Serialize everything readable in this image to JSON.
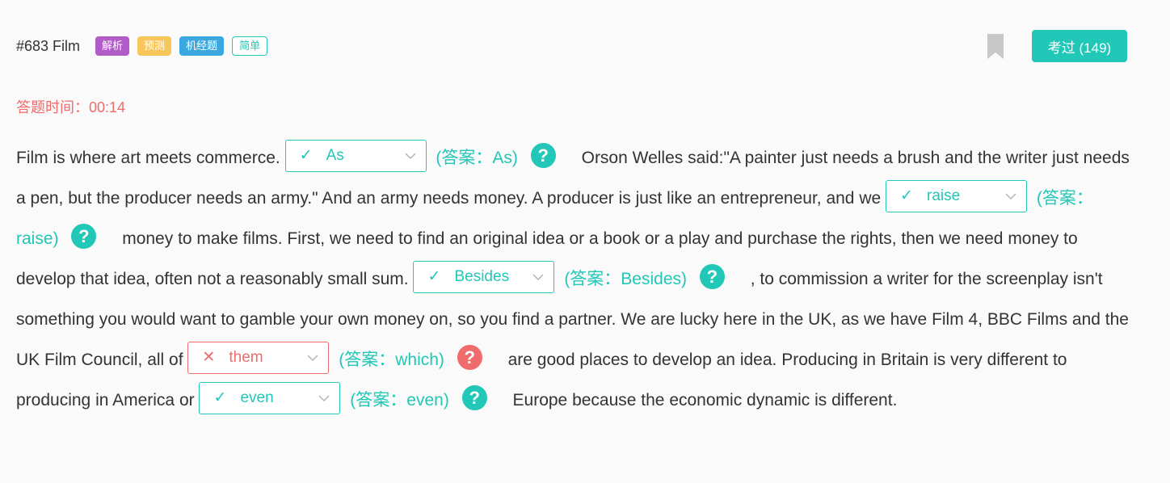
{
  "header": {
    "title": "#683 Film",
    "tags": [
      "解析",
      "预测",
      "机经题",
      "简单"
    ],
    "passed_button": "考过 (149)"
  },
  "timer": "答题时间：00:14",
  "help_glyph": "?",
  "passage": {
    "t1": "Film is where art meets commerce. ",
    "blank1": {
      "mark": "✓",
      "value": "As",
      "answer": "(答案：As)",
      "status": "correct"
    },
    "t2": "Orson Welles said:\"A painter just needs a brush and the writer just needs a pen, but the producer needs an army.\" And an army needs money. A producer is just like an entrepreneur, and we ",
    "blank2": {
      "mark": "✓",
      "value": "raise",
      "answer": "(答案：raise)",
      "status": "correct"
    },
    "t3": "money to make films. First, we need to find an original idea or a book or a play and purchase the rights, then we need money to develop that idea, often not a reasonably small sum. ",
    "blank3": {
      "mark": "✓",
      "value": "Besides",
      "answer": "(答案：Besides)",
      "status": "correct"
    },
    "t4": ", to commission a writer for the screenplay isn't something you would want to gamble your own money on, so you find a partner. We are lucky here in the UK, as we have Film 4, BBC Films and the UK Film Council, all of ",
    "blank4": {
      "mark": "✕",
      "value": "them",
      "answer": "(答案：which)",
      "status": "wrong"
    },
    "t5": "are good places to develop an idea. Producing in Britain is very different to producing in America or ",
    "blank5": {
      "mark": "✓",
      "value": "even",
      "answer": "(答案：even)",
      "status": "correct"
    },
    "t6": "Europe because the economic dynamic is different."
  },
  "colors": {
    "accent": "#21c7b7",
    "error": "#f06b6b",
    "tag_purple": "#b15bc9",
    "tag_yellow": "#f7c75b",
    "tag_blue": "#3aa8df",
    "bookmark": "#c8c8c8"
  },
  "icons": [
    "bookmark-icon",
    "check-icon",
    "cross-icon",
    "chevron-down-icon",
    "help-icon"
  ]
}
